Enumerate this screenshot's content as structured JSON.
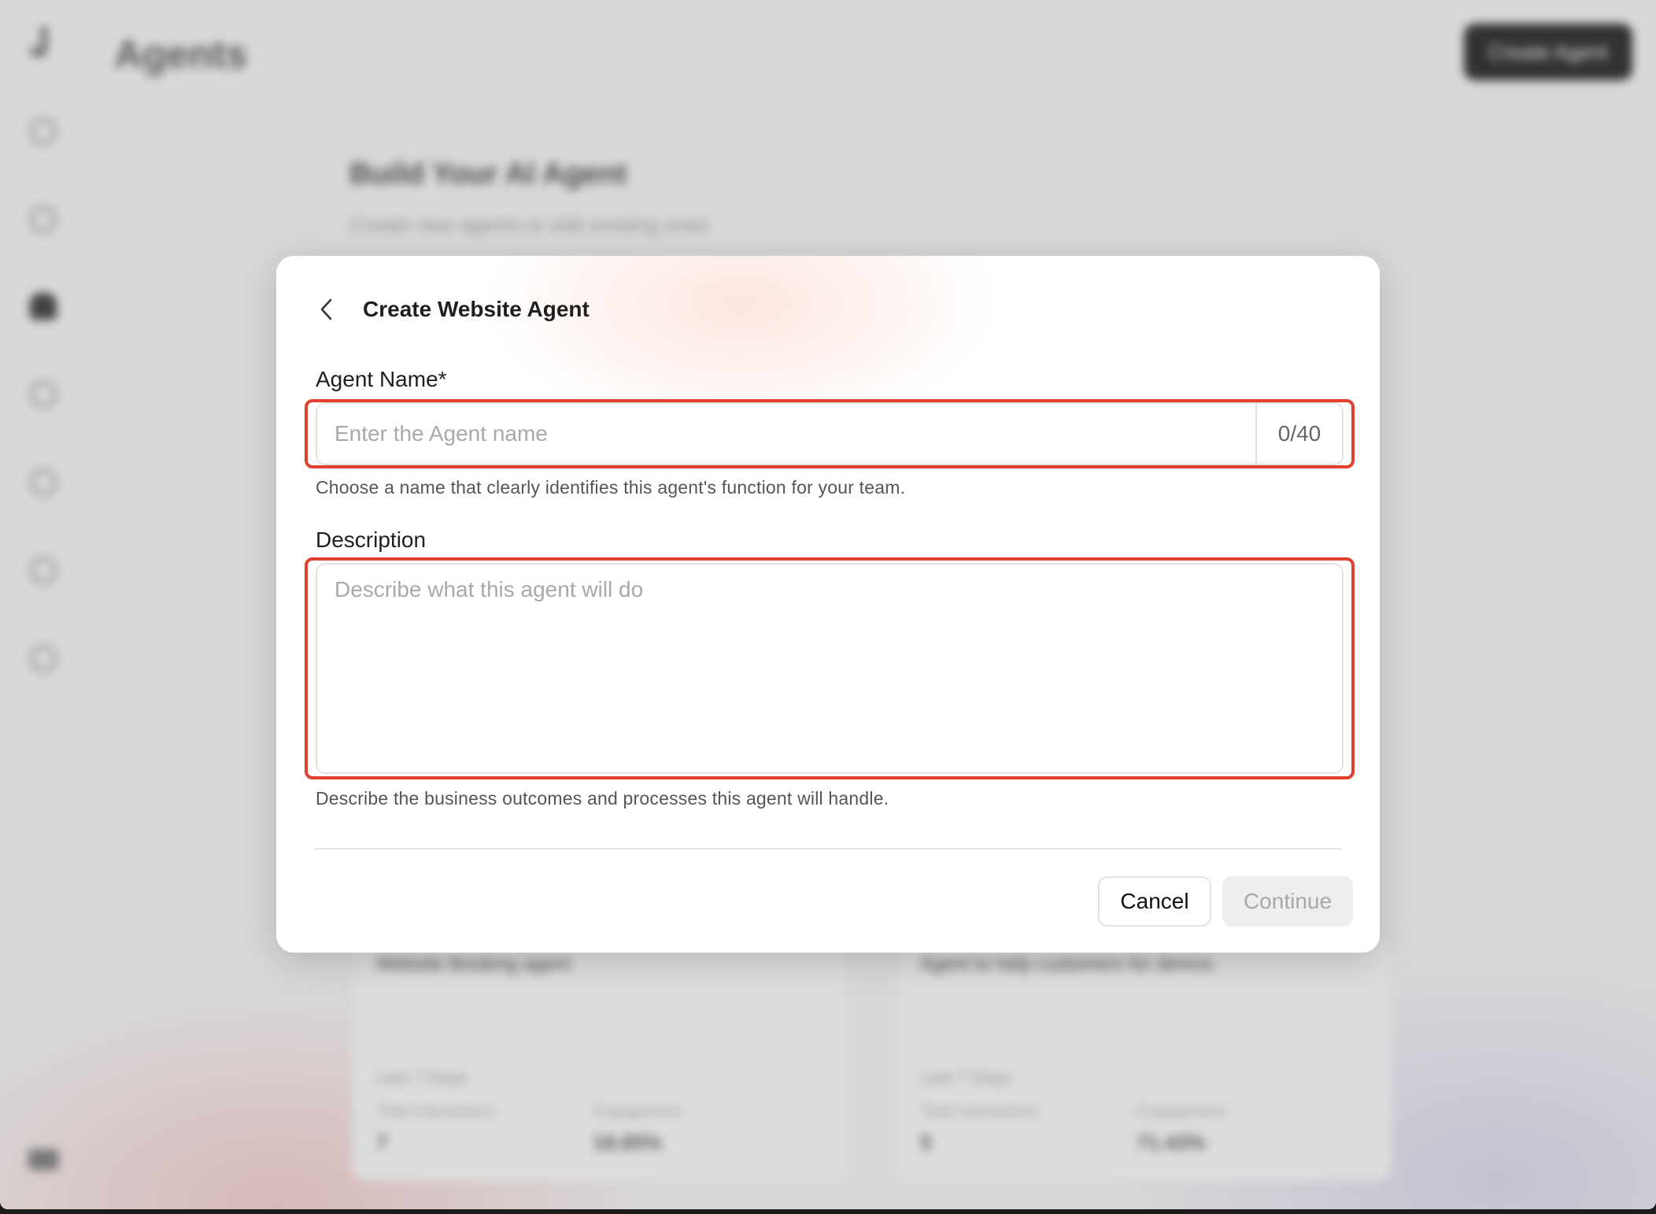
{
  "background": {
    "page_title": "Agents",
    "create_button": "Create Agent",
    "heading": "Build Your AI Agent",
    "subheading": "Create new agents or edit existing ones",
    "cards": [
      {
        "caption": "Website Booking agent",
        "period": "Last 7 Days",
        "metric1_label": "Total Interactions",
        "metric1_value": "7",
        "metric2_label": "Engagement",
        "metric2_value": "18.85%"
      },
      {
        "caption": "Agent to help customers for demos",
        "period": "Last 7 Days",
        "metric1_label": "Total Interactions",
        "metric1_value": "5",
        "metric2_label": "Engagement",
        "metric2_value": "71.43%"
      }
    ]
  },
  "dialog": {
    "title": "Create Website Agent",
    "agent_name": {
      "label": "Agent Name*",
      "placeholder": "Enter the Agent name",
      "value": "",
      "counter": "0/40",
      "helper": "Choose a name that clearly identifies this agent's function for your team."
    },
    "description": {
      "label": "Description",
      "placeholder": "Describe what this agent will do",
      "value": "",
      "helper": "Describe the business outcomes and processes this agent will handle."
    },
    "buttons": {
      "cancel": "Cancel",
      "continue": "Continue"
    }
  },
  "colors": {
    "highlight": "#e0412f",
    "primary_dark": "#1f1f1f",
    "disabled_bg": "#eeeeee"
  },
  "icons": [
    "back-chevron-icon",
    "home-icon",
    "user-icon",
    "agent-icon",
    "chat-icon",
    "grid-icon",
    "docs-icon",
    "settings-icon"
  ]
}
